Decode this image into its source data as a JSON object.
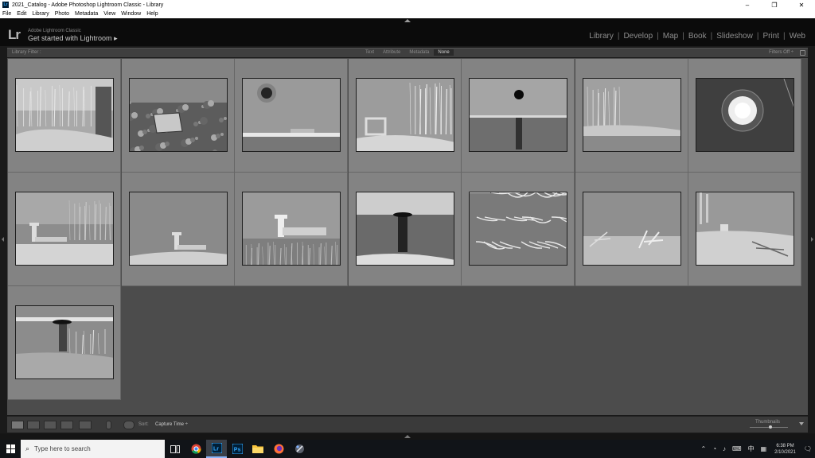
{
  "window": {
    "title": "2021_Catalog - Adobe Photoshop Lightroom Classic - Library",
    "app_icon": "Lr"
  },
  "menu": [
    "File",
    "Edit",
    "Library",
    "Photo",
    "Metadata",
    "View",
    "Window",
    "Help"
  ],
  "identity": {
    "logo": "Lr",
    "subtitle": "Adobe Lightroom Classic",
    "get_started": "Get started with Lightroom",
    "get_started_arrow": "▸"
  },
  "modules": [
    {
      "label": "Library",
      "active": true
    },
    {
      "label": "Develop",
      "active": false
    },
    {
      "label": "Map",
      "active": false
    },
    {
      "label": "Book",
      "active": false
    },
    {
      "label": "Slideshow",
      "active": false
    },
    {
      "label": "Print",
      "active": false
    },
    {
      "label": "Web",
      "active": false
    }
  ],
  "filter": {
    "title": "Library Filter :",
    "tabs": [
      {
        "label": "Text",
        "active": false
      },
      {
        "label": "Attribute",
        "active": false
      },
      {
        "label": "Metadata",
        "active": false
      },
      {
        "label": "None",
        "active": true
      }
    ],
    "filters_off": "Filters Off ÷"
  },
  "photos": [
    {
      "scene": "woods"
    },
    {
      "scene": "rubble"
    },
    {
      "scene": "sun"
    },
    {
      "scene": "pier-trees"
    },
    {
      "scene": "sun-water"
    },
    {
      "scene": "shore-trees"
    },
    {
      "scene": "lamp"
    },
    {
      "scene": "tower"
    },
    {
      "scene": "tower-wide"
    },
    {
      "scene": "tower-close"
    },
    {
      "scene": "reflection"
    },
    {
      "scene": "ice"
    },
    {
      "scene": "driftwood"
    },
    {
      "scene": "beach-trees"
    },
    {
      "scene": "dark-water"
    }
  ],
  "toolbar": {
    "sort_label": "Sort:",
    "sort_value": "Capture Time ÷",
    "thumbnails_label": "Thumbnails"
  },
  "taskbar": {
    "search_placeholder": "Type here to search",
    "time": "6:38 PM",
    "date": "2/10/2021",
    "notification_count": "3"
  },
  "colors": {
    "lr_blue": "#31a8ff",
    "ps_blue": "#31a8ff",
    "cell_gray": "#838383",
    "grid_bg": "#4c4c4c"
  }
}
